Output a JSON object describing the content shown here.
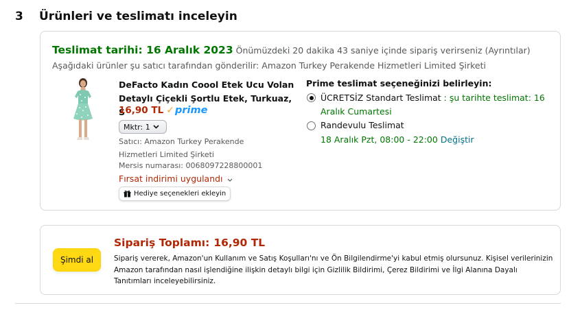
{
  "section": {
    "number": "3",
    "title": "Ürünleri ve teslimatı inceleyin"
  },
  "delivery": {
    "date_label": "Teslimat tarihi: 16 Aralık 2023",
    "note": "Önümüzdeki 20 dakika 43 saniye içinde sipariş verirseniz (Ayrıntılar)",
    "shipper": "Aşağıdaki ürünler şu satıcı tarafından gönderilir: Amazon Turkey Perakende Hizmetleri Limited Şirketi"
  },
  "product": {
    "title": "DeFacto Kadın Coool Etek Ucu Volan Detaylı Çiçekli Şortlu Etek, Turkuaz, S",
    "price": "16,90 TL",
    "prime_label": "prime",
    "prime_check": "✓",
    "qty_label": "Mktr:",
    "qty_value": "1",
    "seller": "Satıcı: Amazon Turkey Perakende Hizmetleri Limited Şirketi",
    "mersis": "Mersis numarası: 0068097228800001",
    "deal": "Fırsat indirimi uygulandı",
    "gift_button": "Hediye seçenekleri ekleyin"
  },
  "shipping": {
    "heading": "Prime teslimat seçeneğinizi belirleyin:",
    "options": [
      {
        "label": "ÜCRETSİZ Standart Teslimat",
        "detail": ": şu tarihte teslimat: 16 Aralık Cumartesi",
        "selected": true
      },
      {
        "label": "Randevulu Teslimat",
        "detail": "18 Aralık Pzt, 08:00 - 22:00",
        "link": "Değiştir",
        "selected": false
      }
    ]
  },
  "order": {
    "buy_button": "Şimdi al",
    "total_label": "Sipariş Toplamı:",
    "total_value": "16,90 TL",
    "legal": "Sipariş vererek, Amazon'un Kullanım ve Satış Koşulları'nı ve Ön Bilgilendirme'yi kabul etmiş olursunuz. Kişisel verilerinizin Amazon tarafından nasıl işlendiğine ilişkin detaylı bilgi için Gizlilik Bildirimi, Çerez Bildirimi ve İlgi Alanına Dayalı Tanıtımları inceleyebilirsiniz."
  },
  "colors": {
    "delivery_green": "#007600",
    "price_red": "#b12704",
    "prime_blue": "#1a98ff",
    "buy_yellow": "#ffd814",
    "link_teal": "#007185"
  },
  "icons": {
    "prime_check": "check-icon",
    "qty_chevron": "chevron-down-icon",
    "deal_chevron": "chevron-down-icon",
    "gift": "gift-icon",
    "product_image": "dress-thumbnail"
  }
}
